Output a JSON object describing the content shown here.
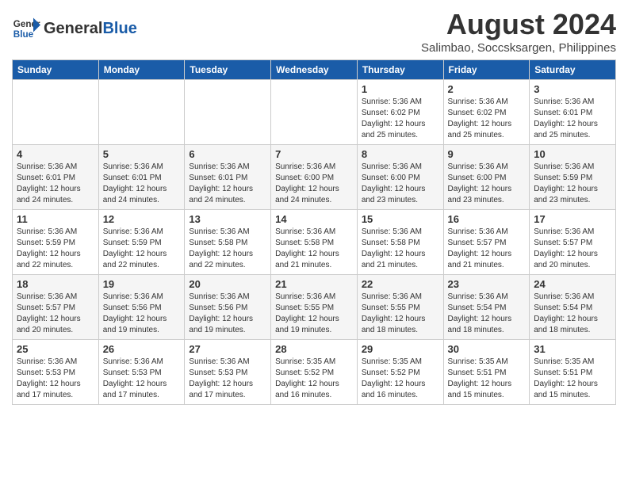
{
  "logo": {
    "text_general": "General",
    "text_blue": "Blue"
  },
  "header": {
    "month_year": "August 2024",
    "location": "Salimbao, Soccsksargen, Philippines"
  },
  "days_of_week": [
    "Sunday",
    "Monday",
    "Tuesday",
    "Wednesday",
    "Thursday",
    "Friday",
    "Saturday"
  ],
  "weeks": [
    [
      {
        "day": "",
        "content": ""
      },
      {
        "day": "",
        "content": ""
      },
      {
        "day": "",
        "content": ""
      },
      {
        "day": "",
        "content": ""
      },
      {
        "day": "1",
        "content": "Sunrise: 5:36 AM\nSunset: 6:02 PM\nDaylight: 12 hours\nand 25 minutes."
      },
      {
        "day": "2",
        "content": "Sunrise: 5:36 AM\nSunset: 6:02 PM\nDaylight: 12 hours\nand 25 minutes."
      },
      {
        "day": "3",
        "content": "Sunrise: 5:36 AM\nSunset: 6:01 PM\nDaylight: 12 hours\nand 25 minutes."
      }
    ],
    [
      {
        "day": "4",
        "content": "Sunrise: 5:36 AM\nSunset: 6:01 PM\nDaylight: 12 hours\nand 24 minutes."
      },
      {
        "day": "5",
        "content": "Sunrise: 5:36 AM\nSunset: 6:01 PM\nDaylight: 12 hours\nand 24 minutes."
      },
      {
        "day": "6",
        "content": "Sunrise: 5:36 AM\nSunset: 6:01 PM\nDaylight: 12 hours\nand 24 minutes."
      },
      {
        "day": "7",
        "content": "Sunrise: 5:36 AM\nSunset: 6:00 PM\nDaylight: 12 hours\nand 24 minutes."
      },
      {
        "day": "8",
        "content": "Sunrise: 5:36 AM\nSunset: 6:00 PM\nDaylight: 12 hours\nand 23 minutes."
      },
      {
        "day": "9",
        "content": "Sunrise: 5:36 AM\nSunset: 6:00 PM\nDaylight: 12 hours\nand 23 minutes."
      },
      {
        "day": "10",
        "content": "Sunrise: 5:36 AM\nSunset: 5:59 PM\nDaylight: 12 hours\nand 23 minutes."
      }
    ],
    [
      {
        "day": "11",
        "content": "Sunrise: 5:36 AM\nSunset: 5:59 PM\nDaylight: 12 hours\nand 22 minutes."
      },
      {
        "day": "12",
        "content": "Sunrise: 5:36 AM\nSunset: 5:59 PM\nDaylight: 12 hours\nand 22 minutes."
      },
      {
        "day": "13",
        "content": "Sunrise: 5:36 AM\nSunset: 5:58 PM\nDaylight: 12 hours\nand 22 minutes."
      },
      {
        "day": "14",
        "content": "Sunrise: 5:36 AM\nSunset: 5:58 PM\nDaylight: 12 hours\nand 21 minutes."
      },
      {
        "day": "15",
        "content": "Sunrise: 5:36 AM\nSunset: 5:58 PM\nDaylight: 12 hours\nand 21 minutes."
      },
      {
        "day": "16",
        "content": "Sunrise: 5:36 AM\nSunset: 5:57 PM\nDaylight: 12 hours\nand 21 minutes."
      },
      {
        "day": "17",
        "content": "Sunrise: 5:36 AM\nSunset: 5:57 PM\nDaylight: 12 hours\nand 20 minutes."
      }
    ],
    [
      {
        "day": "18",
        "content": "Sunrise: 5:36 AM\nSunset: 5:57 PM\nDaylight: 12 hours\nand 20 minutes."
      },
      {
        "day": "19",
        "content": "Sunrise: 5:36 AM\nSunset: 5:56 PM\nDaylight: 12 hours\nand 19 minutes."
      },
      {
        "day": "20",
        "content": "Sunrise: 5:36 AM\nSunset: 5:56 PM\nDaylight: 12 hours\nand 19 minutes."
      },
      {
        "day": "21",
        "content": "Sunrise: 5:36 AM\nSunset: 5:55 PM\nDaylight: 12 hours\nand 19 minutes."
      },
      {
        "day": "22",
        "content": "Sunrise: 5:36 AM\nSunset: 5:55 PM\nDaylight: 12 hours\nand 18 minutes."
      },
      {
        "day": "23",
        "content": "Sunrise: 5:36 AM\nSunset: 5:54 PM\nDaylight: 12 hours\nand 18 minutes."
      },
      {
        "day": "24",
        "content": "Sunrise: 5:36 AM\nSunset: 5:54 PM\nDaylight: 12 hours\nand 18 minutes."
      }
    ],
    [
      {
        "day": "25",
        "content": "Sunrise: 5:36 AM\nSunset: 5:53 PM\nDaylight: 12 hours\nand 17 minutes."
      },
      {
        "day": "26",
        "content": "Sunrise: 5:36 AM\nSunset: 5:53 PM\nDaylight: 12 hours\nand 17 minutes."
      },
      {
        "day": "27",
        "content": "Sunrise: 5:36 AM\nSunset: 5:53 PM\nDaylight: 12 hours\nand 17 minutes."
      },
      {
        "day": "28",
        "content": "Sunrise: 5:35 AM\nSunset: 5:52 PM\nDaylight: 12 hours\nand 16 minutes."
      },
      {
        "day": "29",
        "content": "Sunrise: 5:35 AM\nSunset: 5:52 PM\nDaylight: 12 hours\nand 16 minutes."
      },
      {
        "day": "30",
        "content": "Sunrise: 5:35 AM\nSunset: 5:51 PM\nDaylight: 12 hours\nand 15 minutes."
      },
      {
        "day": "31",
        "content": "Sunrise: 5:35 AM\nSunset: 5:51 PM\nDaylight: 12 hours\nand 15 minutes."
      }
    ]
  ]
}
